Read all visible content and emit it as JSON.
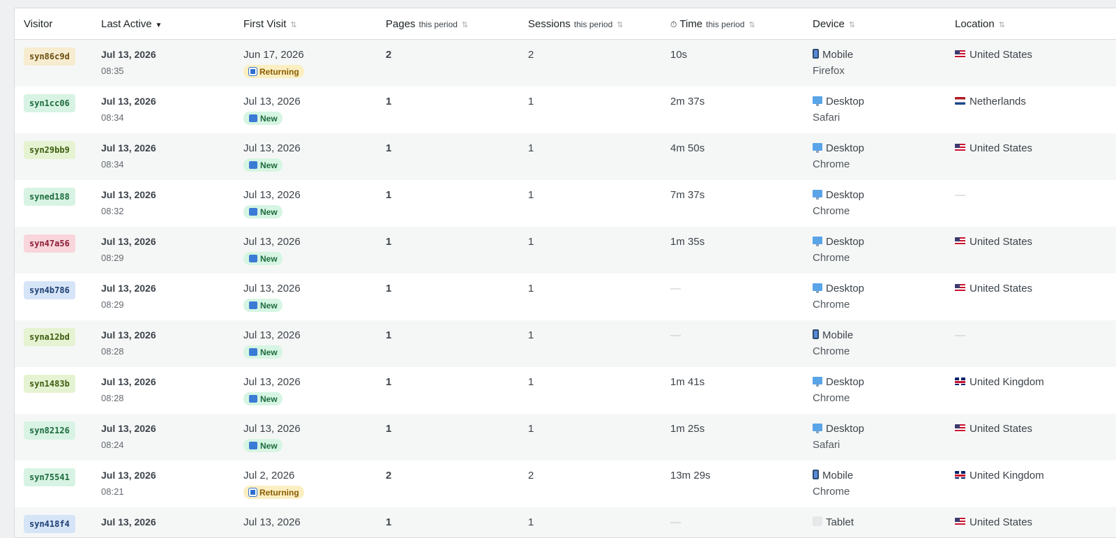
{
  "header": {
    "visitor": "Visitor",
    "last_active": "Last Active",
    "last_active_sort": "▼",
    "first_visit": "First Visit",
    "pages": "Pages",
    "pages_sub": "this period",
    "sessions": "Sessions",
    "sessions_sub": "this period",
    "time_icon": "⏱",
    "time": "Time",
    "time_sub": "this period",
    "device": "Device",
    "location": "Location",
    "sort_icon": "⇅"
  },
  "badge_colors": {
    "yellow": {
      "bg": "#f7ecd0",
      "fg": "#6b4e12"
    },
    "green": {
      "bg": "#d8f3e3",
      "fg": "#1e6b3e"
    },
    "lime": {
      "bg": "#e6f3d2",
      "fg": "#3e5e12"
    },
    "pink": {
      "bg": "#f9d5dc",
      "fg": "#8a1f36"
    },
    "blue": {
      "bg": "#d6e4f7",
      "fg": "#1f3f73"
    }
  },
  "rows": [
    {
      "visitor": "syn86c9d",
      "color": "yellow",
      "last_date": "Jul 13, 2026",
      "last_time": "08:35",
      "first_visit": "Jun 17, 2026",
      "status": "Returning",
      "pages": "2",
      "sessions": "2",
      "time": "10s",
      "device": "Mobile",
      "device_icon": "mobile-icon",
      "browser": "Firefox",
      "location": "United States",
      "flag": "us"
    },
    {
      "visitor": "syn1cc06",
      "color": "green",
      "last_date": "Jul 13, 2026",
      "last_time": "08:34",
      "first_visit": "Jul 13, 2026",
      "status": "New",
      "pages": "1",
      "sessions": "1",
      "time": "2m 37s",
      "device": "Desktop",
      "device_icon": "desktop-icon",
      "browser": "Safari",
      "location": "Netherlands",
      "flag": "nl"
    },
    {
      "visitor": "syn29bb9",
      "color": "lime",
      "last_date": "Jul 13, 2026",
      "last_time": "08:34",
      "first_visit": "Jul 13, 2026",
      "status": "New",
      "pages": "1",
      "sessions": "1",
      "time": "4m 50s",
      "device": "Desktop",
      "device_icon": "desktop-icon",
      "browser": "Chrome",
      "location": "United States",
      "flag": "us"
    },
    {
      "visitor": "syned188",
      "color": "green",
      "last_date": "Jul 13, 2026",
      "last_time": "08:32",
      "first_visit": "Jul 13, 2026",
      "status": "New",
      "pages": "1",
      "sessions": "1",
      "time": "7m 37s",
      "device": "Desktop",
      "device_icon": "desktop-icon",
      "browser": "Chrome",
      "location": "—",
      "flag": ""
    },
    {
      "visitor": "syn47a56",
      "color": "pink",
      "last_date": "Jul 13, 2026",
      "last_time": "08:29",
      "first_visit": "Jul 13, 2026",
      "status": "New",
      "pages": "1",
      "sessions": "1",
      "time": "1m 35s",
      "device": "Desktop",
      "device_icon": "desktop-icon",
      "browser": "Chrome",
      "location": "United States",
      "flag": "us"
    },
    {
      "visitor": "syn4b786",
      "color": "blue",
      "last_date": "Jul 13, 2026",
      "last_time": "08:29",
      "first_visit": "Jul 13, 2026",
      "status": "New",
      "pages": "1",
      "sessions": "1",
      "time": "—",
      "device": "Desktop",
      "device_icon": "desktop-icon",
      "browser": "Chrome",
      "location": "United States",
      "flag": "us"
    },
    {
      "visitor": "syna12bd",
      "color": "lime",
      "last_date": "Jul 13, 2026",
      "last_time": "08:28",
      "first_visit": "Jul 13, 2026",
      "status": "New",
      "pages": "1",
      "sessions": "1",
      "time": "—",
      "device": "Mobile",
      "device_icon": "mobile-icon",
      "browser": "Chrome",
      "location": "—",
      "flag": ""
    },
    {
      "visitor": "syn1483b",
      "color": "lime",
      "last_date": "Jul 13, 2026",
      "last_time": "08:28",
      "first_visit": "Jul 13, 2026",
      "status": "New",
      "pages": "1",
      "sessions": "1",
      "time": "1m 41s",
      "device": "Desktop",
      "device_icon": "desktop-icon",
      "browser": "Chrome",
      "location": "United Kingdom",
      "flag": "gb"
    },
    {
      "visitor": "syn82126",
      "color": "green",
      "last_date": "Jul 13, 2026",
      "last_time": "08:24",
      "first_visit": "Jul 13, 2026",
      "status": "New",
      "pages": "1",
      "sessions": "1",
      "time": "1m 25s",
      "device": "Desktop",
      "device_icon": "desktop-icon",
      "browser": "Safari",
      "location": "United States",
      "flag": "us"
    },
    {
      "visitor": "syn75541",
      "color": "green",
      "last_date": "Jul 13, 2026",
      "last_time": "08:21",
      "first_visit": "Jul 2, 2026",
      "status": "Returning",
      "pages": "2",
      "sessions": "2",
      "time": "13m 29s",
      "device": "Mobile",
      "device_icon": "mobile-icon",
      "browser": "Chrome",
      "location": "United Kingdom",
      "flag": "gb"
    },
    {
      "visitor": "syn418f4",
      "color": "blue",
      "last_date": "Jul 13, 2026",
      "last_time": "",
      "first_visit": "Jul 13, 2026",
      "status": "",
      "pages": "1",
      "sessions": "1",
      "time": "—",
      "device": "Tablet",
      "device_icon": "tablet-icon",
      "browser": "",
      "location": "United States",
      "flag": "us"
    }
  ]
}
